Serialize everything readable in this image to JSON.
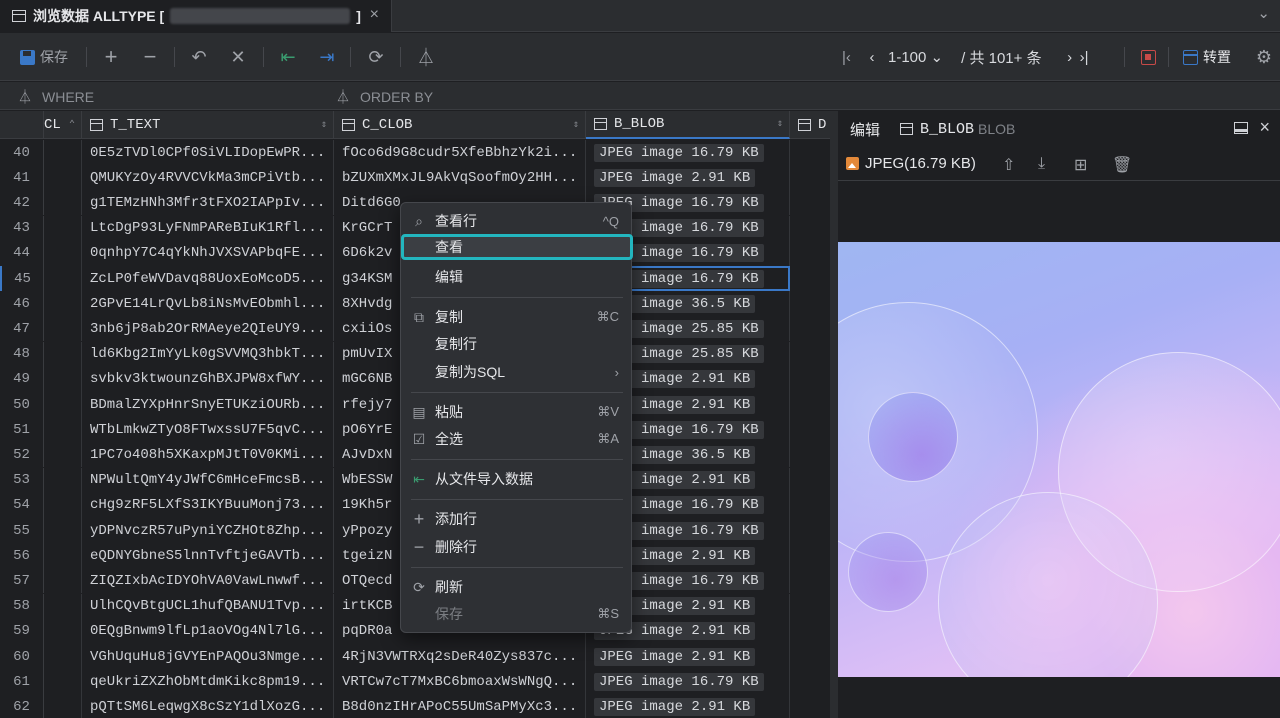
{
  "tab": {
    "title": "浏览数据 ALLTYPE [",
    "title_end": "]"
  },
  "toolbar": {
    "save_label": "保存",
    "page_range": "1-100",
    "page_total": "/ 共 101+ 条",
    "transpose_label": "转置"
  },
  "filters": {
    "where": "WHERE",
    "order_by": "ORDER BY"
  },
  "grid": {
    "columns": [
      {
        "label": "CL"
      },
      {
        "label": "T_TEXT"
      },
      {
        "label": "C_CLOB"
      },
      {
        "label": "B_BLOB"
      },
      {
        "label": "D"
      }
    ],
    "rows": [
      {
        "n": "40",
        "text": "0E5zTVDl0CPf0SiVLIDopEwPR...",
        "clob": "fOco6d9G8cudr5XfeBbhzYk2i...",
        "blob": "JPEG image 16.79 KB"
      },
      {
        "n": "41",
        "text": "QMUKYzOy4RVVCVkMa3mCPiVtb...",
        "clob": "bZUXmXMxJL9AkVqSoofmOy2HH...",
        "blob": "JPEG image 2.91 KB"
      },
      {
        "n": "42",
        "text": "g1TEMzHNh3Mfr3tFXO2IAPpIv...",
        "clob": "Ditd6G0",
        "blob": "JPEG image 16.79 KB"
      },
      {
        "n": "43",
        "text": "LtcDgP93LyFNmPAReBIuK1Rfl...",
        "clob": "KrGCrT",
        "blob": "JPEG image 16.79 KB"
      },
      {
        "n": "44",
        "text": "0qnhpY7C4qYkNhJVXSVAPbqFE...",
        "clob": "6D6k2v",
        "blob": "JPEG image 16.79 KB"
      },
      {
        "n": "45",
        "text": "ZcLP0feWVDavq88UoxEoMcoD5...",
        "clob": "g34KSM",
        "blob": "JPEG image 16.79 KB"
      },
      {
        "n": "46",
        "text": "2GPvE14LrQvLb8iNsMvEObmhl...",
        "clob": "8XHvdg",
        "blob": "JPEG image 36.5 KB"
      },
      {
        "n": "47",
        "text": "3nb6jP8ab2OrRMAeye2QIeUY9...",
        "clob": "cxiiOs",
        "blob": "JPEG image 25.85 KB"
      },
      {
        "n": "48",
        "text": "ld6Kbg2ImYyLk0gSVVMQ3hbkT...",
        "clob": "pmUvIX",
        "blob": "JPEG image 25.85 KB"
      },
      {
        "n": "49",
        "text": "svbkv3ktwounzGhBXJPW8xfWY...",
        "clob": "mGC6NB",
        "blob": "JPEG image 2.91 KB"
      },
      {
        "n": "50",
        "text": "BDmalZYXpHnrSnyETUKziOURb...",
        "clob": "rfejy7",
        "blob": "JPEG image 2.91 KB"
      },
      {
        "n": "51",
        "text": "WTbLmkwZTyO8FTwxssU7F5qvC...",
        "clob": "pO6YrE",
        "blob": "JPEG image 16.79 KB"
      },
      {
        "n": "52",
        "text": "1PC7o408h5XKaxpMJtT0V0KMi...",
        "clob": "AJvDxN",
        "blob": "JPEG image 36.5 KB"
      },
      {
        "n": "53",
        "text": "NPWultQmY4yJWfC6mHceFmcsB...",
        "clob": "WbESSW",
        "blob": "JPEG image 2.91 KB"
      },
      {
        "n": "54",
        "text": "cHg9zRF5LXfS3IKYBuuMonj73...",
        "clob": "19Kh5r",
        "blob": "JPEG image 16.79 KB"
      },
      {
        "n": "55",
        "text": "yDPNvczR57uPyniYCZHOt8Zhp...",
        "clob": "yPpozy",
        "blob": "JPEG image 16.79 KB"
      },
      {
        "n": "56",
        "text": "eQDNYGbneS5lnnTvftjeGAVTb...",
        "clob": "tgeizN",
        "blob": "JPEG image 2.91 KB"
      },
      {
        "n": "57",
        "text": "ZIQZIxbAcIDYOhVA0VawLnwwf...",
        "clob": "OTQecd",
        "blob": "JPEG image 16.79 KB"
      },
      {
        "n": "58",
        "text": "UlhCQvBtgUCL1hufQBANU1Tvp...",
        "clob": "irtKCB",
        "blob": "JPEG image 2.91 KB"
      },
      {
        "n": "59",
        "text": "0EQgBnwm9lfLp1aoVOg4Nl7lG...",
        "clob": "pqDR0a",
        "blob": "JPEG image 2.91 KB"
      },
      {
        "n": "60",
        "text": "VGhUquHu8jGVYEnPAQOu3Nmge...",
        "clob": "4RjN3VWTRXq2sDeR40Zys837c...",
        "blob": "JPEG image 2.91 KB"
      },
      {
        "n": "61",
        "text": "qeUkriZXZhObMtdmKikc8pm19...",
        "clob": "VRTCw7cT7MxBC6bmoaxWsWNgQ...",
        "blob": "JPEG image 16.79 KB"
      },
      {
        "n": "62",
        "text": "pQTtSM6LeqwgX8cSzY1dlXozG...",
        "clob": "B8d0nzIHrAPoC55UmSaPMyXc3...",
        "blob": "JPEG image 2.91 KB"
      }
    ]
  },
  "panel": {
    "title": "编辑",
    "column": "B_BLOB",
    "type": "BLOB",
    "file_label": "JPEG(16.79 KB)"
  },
  "menu": {
    "view_row": "查看行",
    "view_row_key": "^Q",
    "view": "查看",
    "edit": "编辑",
    "copy": "复制",
    "copy_key": "⌘C",
    "copy_row": "复制行",
    "copy_as_sql": "复制为SQL",
    "paste": "粘贴",
    "paste_key": "⌘V",
    "select_all": "全选",
    "select_all_key": "⌘A",
    "import_from_file": "从文件导入数据",
    "add_row": "添加行",
    "delete_row": "删除行",
    "refresh": "刷新",
    "save": "保存",
    "save_key": "⌘S"
  }
}
